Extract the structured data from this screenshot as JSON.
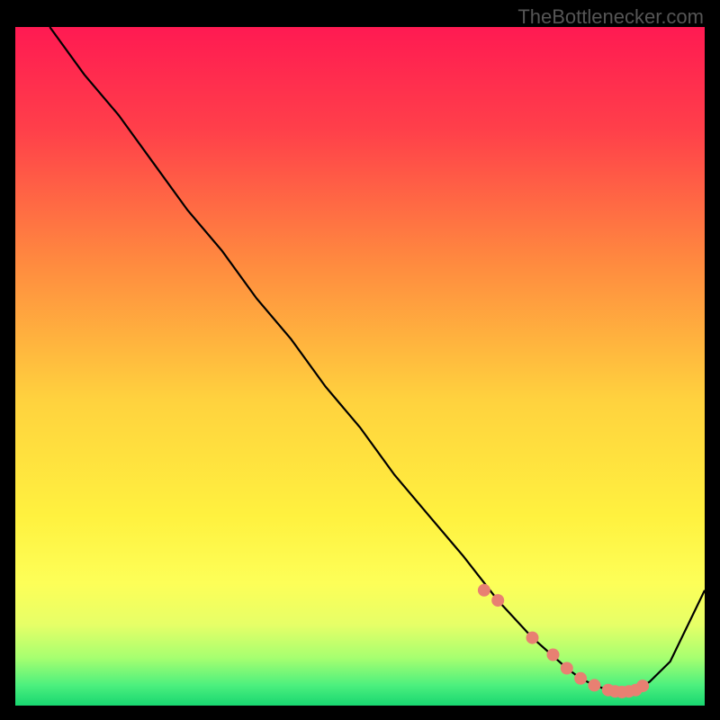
{
  "watermark": "TheBottlenecker.com",
  "chart_data": {
    "type": "line",
    "title": "",
    "xlabel": "",
    "ylabel": "",
    "xlim": [
      0,
      100
    ],
    "ylim": [
      0,
      100
    ],
    "grid": false,
    "legend": "none",
    "series": [
      {
        "name": "curve",
        "x": [
          5,
          10,
          15,
          20,
          25,
          30,
          35,
          40,
          45,
          50,
          55,
          60,
          65,
          70,
          75,
          80,
          82,
          84,
          86,
          88,
          90,
          92,
          95,
          100
        ],
        "y": [
          100,
          93,
          87,
          80,
          73,
          67,
          60,
          54,
          47,
          41,
          34,
          28,
          22,
          15.5,
          10,
          5.5,
          4,
          3,
          2.3,
          2,
          2.3,
          3.5,
          6.5,
          17
        ]
      }
    ],
    "highlight_points": {
      "name": "markers",
      "x": [
        68,
        70,
        75,
        78,
        80,
        82,
        84,
        86,
        87,
        88,
        89,
        90,
        91
      ],
      "y": [
        17,
        15.5,
        10,
        7.5,
        5.5,
        4,
        3,
        2.3,
        2.1,
        2,
        2.1,
        2.3,
        2.9
      ]
    },
    "gradient_stops": [
      {
        "offset": 0.0,
        "color": "#ff1a52"
      },
      {
        "offset": 0.15,
        "color": "#ff3f4a"
      },
      {
        "offset": 0.35,
        "color": "#ff8b3f"
      },
      {
        "offset": 0.55,
        "color": "#ffd23e"
      },
      {
        "offset": 0.72,
        "color": "#fff13f"
      },
      {
        "offset": 0.82,
        "color": "#fdff58"
      },
      {
        "offset": 0.88,
        "color": "#e7ff67"
      },
      {
        "offset": 0.93,
        "color": "#a6ff70"
      },
      {
        "offset": 0.97,
        "color": "#4cf07e"
      },
      {
        "offset": 1.0,
        "color": "#18d670"
      }
    ],
    "marker_color": "#e88072",
    "line_color": "#000000"
  }
}
